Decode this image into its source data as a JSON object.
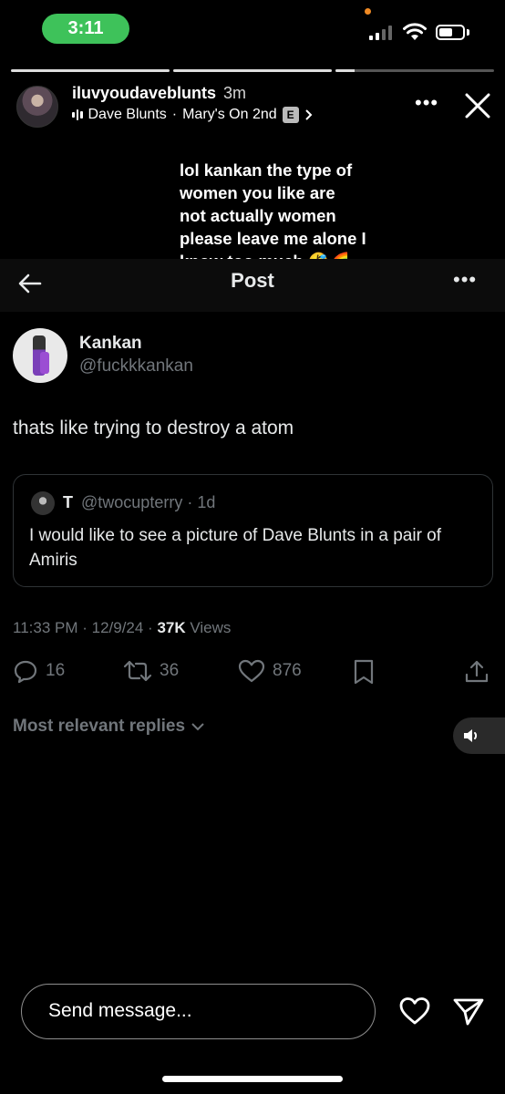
{
  "status_bar": {
    "time": "3:11",
    "accent_color": "#3ec25a"
  },
  "story": {
    "progress": [
      1.0,
      1.0,
      0.12
    ],
    "username": "iluvyoudaveblunts",
    "age": "3m",
    "music_artist": "Dave Blunts",
    "music_separator": "·",
    "music_track": "Mary's On 2nd",
    "explicit_label": "E",
    "more_icon": "more-horizontal-icon",
    "close_icon": "close-icon",
    "caption_lines": [
      "lol kankan the type of",
      "women you like are",
      "not actually women",
      "please leave me alone I",
      "know too much 🤣🌈"
    ]
  },
  "post_bar": {
    "title": "Post",
    "back_icon": "back-arrow-icon",
    "more_icon": "more-horizontal-icon"
  },
  "post": {
    "author_name": "Kankan",
    "author_handle": "@fuckkkankan",
    "text": "thats like trying to destroy a atom",
    "quote": {
      "name": "T",
      "handle": "@twocupterry",
      "age": "· 1d",
      "text": "I would like to see a picture of Dave Blunts in a pair of Amiris"
    },
    "timestamp": "11:33 PM · 12/9/24 · ",
    "views_count": "37K",
    "views_label": " Views",
    "replies": "16",
    "reposts": "36",
    "likes": "876",
    "replies_filter": "Most relevant replies"
  },
  "message_bar": {
    "placeholder": "Send message...",
    "heart_icon": "heart-icon",
    "send_icon": "send-icon"
  }
}
